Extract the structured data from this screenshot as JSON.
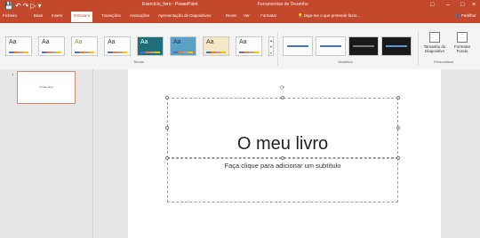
{
  "titlebar": {
    "qat_icons": [
      "save-icon",
      "undo-icon",
      "redo-icon",
      "present-icon",
      "customize-qat-icon"
    ],
    "doc_title": "Exercício_livro - PowerPoint",
    "context_title": "Ferramentas de Desenho",
    "window_controls": [
      "ribbon-options-icon",
      "minimize-icon",
      "maximize-icon",
      "close-icon"
    ]
  },
  "tabs": [
    {
      "label": "Ficheiro"
    },
    {
      "label": "Base"
    },
    {
      "label": "Inserir"
    },
    {
      "label": "Estrutura",
      "active": true
    },
    {
      "label": "Transições"
    },
    {
      "label": "Animações"
    },
    {
      "label": "Apresentação de Diapositivos"
    },
    {
      "label": "Rever"
    },
    {
      "label": "Ver"
    },
    {
      "label": "Formatar"
    }
  ],
  "search": {
    "placeholder": "Diga-me o que pretende fazer..."
  },
  "share": {
    "label": "Partilhar"
  },
  "themes": [
    {
      "aa": "Aa",
      "bg": "#ffffff",
      "fg": "#333333"
    },
    {
      "aa": "Aa",
      "bg": "#ffffff",
      "fg": "#333333"
    },
    {
      "aa": "Aa",
      "bg": "#ffffff",
      "fg": "#6e9e3c"
    },
    {
      "aa": "Aa",
      "bg": "#ffffff",
      "fg": "#333333"
    },
    {
      "aa": "Aa",
      "bg": "#1f6f7a",
      "fg": "#ffffff"
    },
    {
      "aa": "Aa",
      "bg": "#5aa1c8",
      "fg": "#1a3a5a"
    },
    {
      "aa": "Aa",
      "bg": "#f3e9c7",
      "fg": "#333333"
    },
    {
      "aa": "Aa",
      "bg": "#ffffff",
      "fg": "#333333"
    }
  ],
  "variants": [
    {
      "bg": "#ffffff",
      "line": "#4472c4"
    },
    {
      "bg": "#ffffff",
      "line": "#4472c4"
    },
    {
      "bg": "#1a1a1a",
      "line": "#7a7a7a"
    },
    {
      "bg": "#1a1a1a",
      "line": "#5b9bd5"
    }
  ],
  "groups": {
    "themes": "Temas",
    "variants": "Variantes",
    "customize": "Personalizar"
  },
  "customize": {
    "slide_size": "Tamanho do Diapositivo",
    "format_background": "Formatar Fundo"
  },
  "thumbnail": {
    "number": "1",
    "title": "O meu livro"
  },
  "slide": {
    "title": "O meu livro",
    "subtitle": "Faça clique para adicionar um subtítulo"
  },
  "colors": {
    "accent": "#c4482b"
  }
}
